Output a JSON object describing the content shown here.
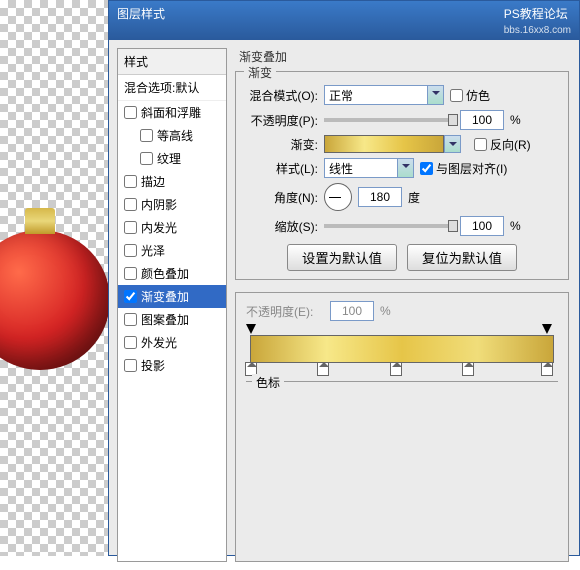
{
  "titlebar": {
    "title": "图层样式",
    "credit1": "PS教程论坛",
    "credit2": "bbs.16xx8.com"
  },
  "styles": {
    "header": "样式",
    "blend_default": "混合选项:默认",
    "items": [
      {
        "label": "斜面和浮雕",
        "checked": false,
        "indent": false
      },
      {
        "label": "等高线",
        "checked": false,
        "indent": true
      },
      {
        "label": "纹理",
        "checked": false,
        "indent": true
      },
      {
        "label": "描边",
        "checked": false,
        "indent": false
      },
      {
        "label": "内阴影",
        "checked": false,
        "indent": false
      },
      {
        "label": "内发光",
        "checked": false,
        "indent": false
      },
      {
        "label": "光泽",
        "checked": false,
        "indent": false
      },
      {
        "label": "颜色叠加",
        "checked": false,
        "indent": false
      },
      {
        "label": "渐变叠加",
        "checked": true,
        "indent": false,
        "selected": true
      },
      {
        "label": "图案叠加",
        "checked": false,
        "indent": false
      },
      {
        "label": "外发光",
        "checked": false,
        "indent": false
      },
      {
        "label": "投影",
        "checked": false,
        "indent": false
      }
    ]
  },
  "main": {
    "heading": "渐变叠加",
    "subheading": "渐变",
    "blend_mode_label": "混合模式(O):",
    "blend_mode_value": "正常",
    "dither_label": "仿色",
    "opacity_label": "不透明度(P):",
    "opacity_value": "100",
    "percent": "%",
    "gradient_label": "渐变:",
    "reverse_label": "反向(R)",
    "style_label": "样式(L):",
    "style_value": "线性",
    "align_label": "与图层对齐(I)",
    "angle_label": "角度(N):",
    "angle_value": "180",
    "degree": "度",
    "scale_label": "缩放(S):",
    "scale_value": "100",
    "set_default": "设置为默认值",
    "reset_default": "复位为默认值"
  },
  "editor": {
    "opacity_label": "不透明度(E):",
    "opacity_value": "100",
    "percent": "%",
    "colorstops_label": "色标",
    "gradient_colors": [
      "#c9a63a",
      "#f7e889",
      "#e6c548",
      "#f0dd7a",
      "#c9a63a"
    ],
    "bottom_stops": [
      0,
      24,
      48,
      72,
      98
    ],
    "top_stops": [
      0,
      98
    ]
  }
}
